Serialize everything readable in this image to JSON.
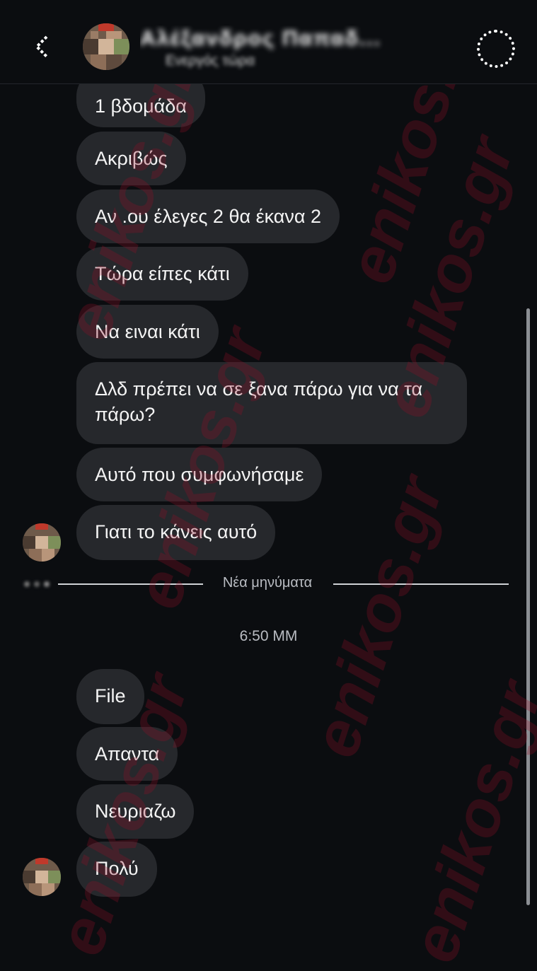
{
  "header": {
    "back_icon": "chevron-left-icon",
    "contact_name": "Αλέξανδρος Παπαδ...",
    "contact_status": "Ενεργός τώρα",
    "info_icon": "info-icon"
  },
  "messages_top": [
    {
      "text": "1 βδομάδα"
    },
    {
      "text": "Ακριβώς"
    },
    {
      "text": "Αν .ου έλεγες 2 θα έκανα 2"
    },
    {
      "text": "Τώρα είπες κάτι"
    },
    {
      "text": "Να ειναι κάτι"
    },
    {
      "text": "Δλδ πρέπει να σε ξανα πάρω για να τα πάρω?"
    },
    {
      "text": "Αυτό που συμφωνήσαμε"
    },
    {
      "text": "Γιατι το κάνεις αυτό"
    }
  ],
  "divider": {
    "label": "Νέα μηνύματα"
  },
  "timestamp": "6:50 ΜΜ",
  "messages_bottom": [
    {
      "text": "File"
    },
    {
      "text": "Απαντα"
    },
    {
      "text": "Νευριαζω"
    },
    {
      "text": "Πολύ"
    }
  ],
  "watermark": "enikos.gr",
  "colors": {
    "background": "#0b0d10",
    "bubble": "#26282c",
    "text": "#f4f4f4",
    "muted": "#b9bcc2",
    "watermark": "#960f28"
  }
}
